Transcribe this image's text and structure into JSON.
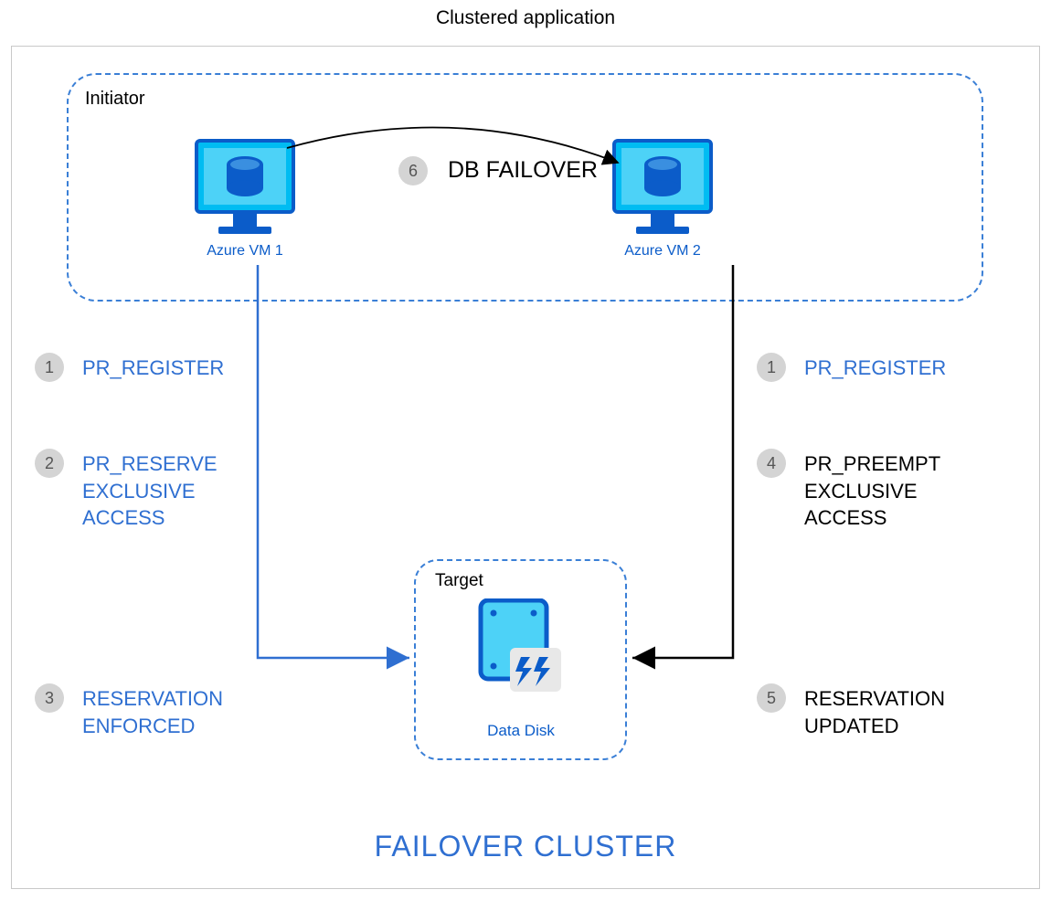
{
  "title": "Clustered application",
  "initiator": {
    "label": "Initiator"
  },
  "target": {
    "label": "Target",
    "disk_label": "Data Disk"
  },
  "vm1": {
    "label": "Azure VM 1"
  },
  "vm2": {
    "label": "Azure VM 2"
  },
  "failover": {
    "badge": "6",
    "label": "DB FAILOVER"
  },
  "steps_left": [
    {
      "n": "1",
      "text": "PR_REGISTER"
    },
    {
      "n": "2",
      "text": "PR_RESERVE\nEXCLUSIVE\nACCESS"
    },
    {
      "n": "3",
      "text": "RESERVATION\nENFORCED"
    }
  ],
  "steps_right": [
    {
      "n": "1",
      "text": "PR_REGISTER"
    },
    {
      "n": "4",
      "text": "PR_PREEMPT\nEXCLUSIVE\nACCESS"
    },
    {
      "n": "5",
      "text": "RESERVATION\nUPDATED"
    }
  ],
  "footer": "FAILOVER CLUSTER",
  "colors": {
    "azure_blue": "#00bcf2",
    "azure_dark": "#0b5cc9",
    "step_blue": "#2f6fd1"
  }
}
